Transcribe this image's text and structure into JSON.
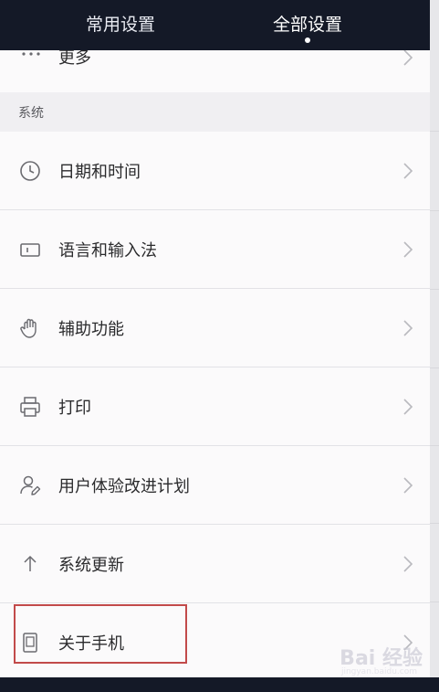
{
  "tabs": {
    "common": "常用设置",
    "all": "全部设置"
  },
  "partial_row": {
    "label": "更多",
    "icon": "more-dots-icon"
  },
  "section": {
    "title": "系统"
  },
  "rows": [
    {
      "label": "日期和时间",
      "icon": "clock-icon"
    },
    {
      "label": "语言和输入法",
      "icon": "keyboard-icon"
    },
    {
      "label": "辅助功能",
      "icon": "hand-icon"
    },
    {
      "label": "打印",
      "icon": "printer-icon"
    },
    {
      "label": "用户体验改进计划",
      "icon": "user-edit-icon"
    },
    {
      "label": "系统更新",
      "icon": "arrow-up-icon"
    },
    {
      "label": "关于手机",
      "icon": "phone-icon"
    }
  ],
  "colors": {
    "topbar": "#141927",
    "highlight_border": "#c24a4a",
    "icon": "#6b6b70",
    "chevron": "#b9b9be"
  },
  "watermark": {
    "text": "Bai 经验",
    "sub": "jingyan.baidu.com"
  }
}
